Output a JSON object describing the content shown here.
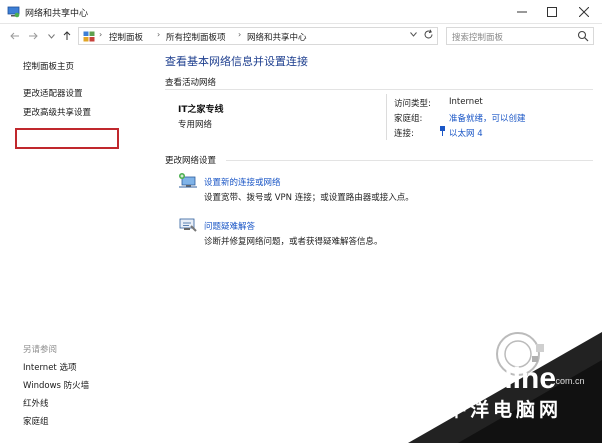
{
  "window": {
    "title": "网络和共享中心"
  },
  "address": {
    "breadcrumbs": [
      "控制面板",
      "所有控制面板项",
      "网络和共享中心"
    ],
    "search_placeholder": "搜索控制面板"
  },
  "sidebar": {
    "items": [
      {
        "label": "控制面板主页"
      },
      {
        "label": "更改适配器设置"
      },
      {
        "label": "更改高级共享设置"
      }
    ],
    "see_also_title": "另请参阅",
    "see_also": [
      {
        "label": "Internet 选项"
      },
      {
        "label": "Windows 防火墙"
      },
      {
        "label": "红外线"
      },
      {
        "label": "家庭组"
      }
    ]
  },
  "main": {
    "heading": "查看基本网络信息并设置连接",
    "active_section": "查看活动网络",
    "network": {
      "name": "IT之家专线",
      "type": "专用网络",
      "access_type_label": "访问类型:",
      "access_type_value": "Internet",
      "homegroup_label": "家庭组:",
      "homegroup_value": "准备就绪，可以创建",
      "connection_label": "连接:",
      "connection_value": "以太网 4"
    },
    "change_section": "更改网络设置",
    "tasks": [
      {
        "link": "设置新的连接或网络",
        "desc": "设置宽带、拨号或 VPN 连接；或设置路由器或接入点。"
      },
      {
        "link": "问题疑难解答",
        "desc": "诊断并修复网络问题，或者获得疑难解答信息。"
      }
    ]
  },
  "watermark": {
    "brand": "PConline",
    "domain": ".com.cn",
    "cn_name": "太平洋电脑网"
  },
  "colors": {
    "link": "#1a56c6",
    "heading": "#1e3f8f",
    "highlight_border": "#c0282d"
  }
}
